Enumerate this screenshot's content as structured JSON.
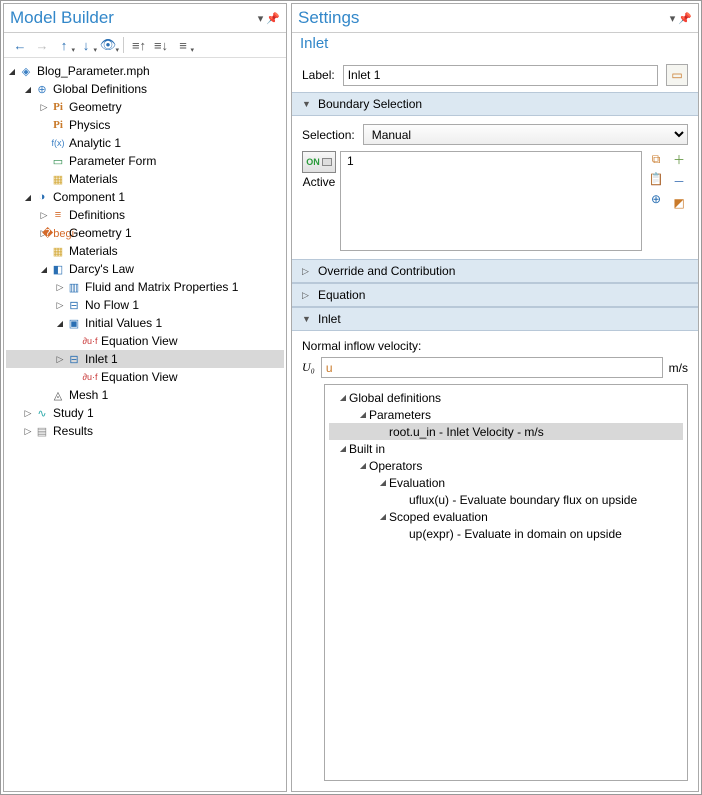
{
  "left": {
    "title": "Model Builder",
    "tree": [
      {
        "d": 0,
        "tw": "▲",
        "ic": "i-root",
        "g": "◈",
        "t": "Blog_Parameter.mph"
      },
      {
        "d": 1,
        "tw": "▲",
        "ic": "i-globe",
        "g": "⊕",
        "t": "Global Definitions"
      },
      {
        "d": 2,
        "tw": "▷",
        "ic": "i-pi",
        "g": "Pi",
        "t": "Geometry"
      },
      {
        "d": 2,
        "tw": "",
        "ic": "i-pi",
        "g": "Pi",
        "t": "Physics"
      },
      {
        "d": 2,
        "tw": "",
        "ic": "i-fx",
        "g": "f(x)",
        "t": "Analytic 1"
      },
      {
        "d": 2,
        "tw": "",
        "ic": "i-form",
        "g": "▭",
        "t": "Parameter Form"
      },
      {
        "d": 2,
        "tw": "",
        "ic": "i-mat",
        "g": "▦",
        "t": "Materials"
      },
      {
        "d": 1,
        "tw": "▲",
        "ic": "i-comp",
        "g": "◑",
        "t": "Component 1"
      },
      {
        "d": 2,
        "tw": "▷",
        "ic": "i-def",
        "g": "≡",
        "t": "Definitions"
      },
      {
        "d": 2,
        "tw": "▷",
        "ic": "i-geo",
        "g": "�begi",
        "t": "Geometry 1",
        "gl": "⫠"
      },
      {
        "d": 2,
        "tw": "",
        "ic": "i-mat",
        "g": "▦",
        "t": "Materials"
      },
      {
        "d": 2,
        "tw": "▲",
        "ic": "i-darcy",
        "g": "◧",
        "t": "Darcy's Law"
      },
      {
        "d": 3,
        "tw": "▷",
        "ic": "i-fluid",
        "g": "▥",
        "t": "Fluid and Matrix Properties 1"
      },
      {
        "d": 3,
        "tw": "▷",
        "ic": "i-nf",
        "g": "⊟",
        "t": "No Flow 1"
      },
      {
        "d": 3,
        "tw": "▲",
        "ic": "i-iv",
        "g": "▣",
        "t": "Initial Values 1"
      },
      {
        "d": 4,
        "tw": "",
        "ic": "i-eq",
        "g": "∂u·f",
        "t": "Equation View"
      },
      {
        "d": 3,
        "tw": "▷",
        "ic": "i-inlet",
        "g": "⊟",
        "t": "Inlet 1",
        "sel": true
      },
      {
        "d": 4,
        "tw": "",
        "ic": "i-eq",
        "g": "∂u·f",
        "t": "Equation View"
      },
      {
        "d": 2,
        "tw": "",
        "ic": "i-mesh",
        "g": "◬",
        "t": "Mesh 1"
      },
      {
        "d": 1,
        "tw": "▷",
        "ic": "i-study",
        "g": "∿",
        "t": "Study 1"
      },
      {
        "d": 1,
        "tw": "▷",
        "ic": "i-res",
        "g": "▤",
        "t": "Results"
      }
    ]
  },
  "right": {
    "title": "Settings",
    "subtitle": "Inlet",
    "label_lbl": "Label:",
    "label_val": "Inlet 1",
    "sections": {
      "boundary": "Boundary Selection",
      "override": "Override and Contribution",
      "equation": "Equation",
      "inlet": "Inlet"
    },
    "selection_lbl": "Selection:",
    "selection_val": "Manual",
    "active": "Active",
    "on": "ON",
    "list_item": "1",
    "normal_lbl": "Normal inflow velocity:",
    "u0": "U₀",
    "u0_val": "u",
    "u0_unit": "m/s",
    "ac": [
      {
        "d": 0,
        "tw": "▲",
        "t": "Global definitions"
      },
      {
        "d": 1,
        "tw": "▲",
        "t": "Parameters"
      },
      {
        "d": 2,
        "tw": "",
        "t": "root.u_in - Inlet Velocity - m/s",
        "hl": true
      },
      {
        "d": 0,
        "tw": "▲",
        "t": "Built in"
      },
      {
        "d": 1,
        "tw": "▲",
        "t": "Operators"
      },
      {
        "d": 2,
        "tw": "▲",
        "t": "Evaluation"
      },
      {
        "d": 3,
        "tw": "",
        "t": "uflux(u) - Evaluate boundary flux on upside"
      },
      {
        "d": 2,
        "tw": "▲",
        "t": "Scoped evaluation"
      },
      {
        "d": 3,
        "tw": "",
        "t": "up(expr) - Evaluate in domain on upside"
      }
    ]
  }
}
